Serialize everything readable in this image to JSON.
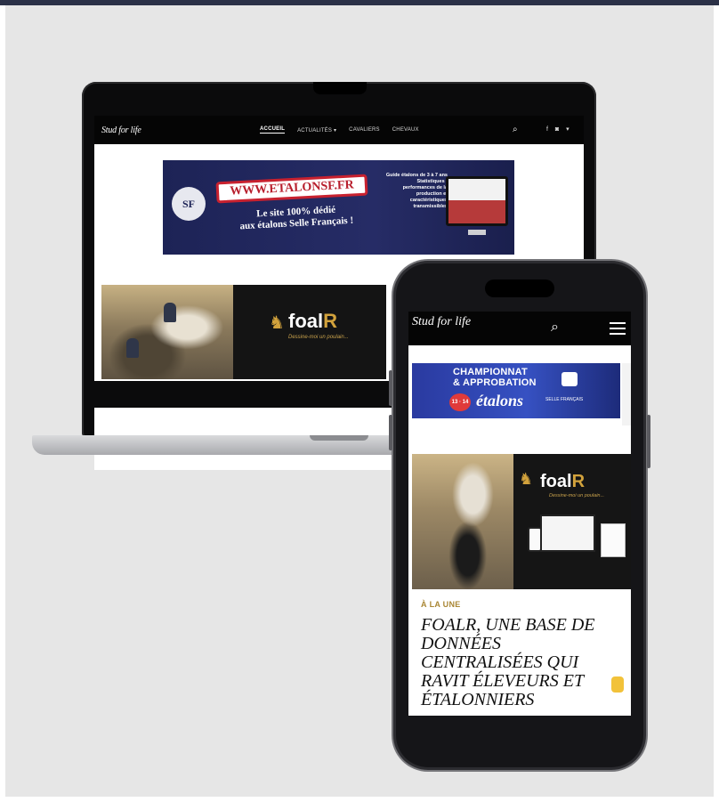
{
  "colors": {
    "border_top": "#2b3147",
    "background": "#e6e6e6",
    "device_black": "#0b0b0c",
    "gold_accent": "#d2a23c",
    "banner_navy": "#1d2356",
    "banner_red": "#c8212f"
  },
  "laptop": {
    "logo": "Stud for life",
    "nav": {
      "items": [
        "ACCUEIL",
        "ACTUALITÉS ▾",
        "CAVALIERS",
        "CHEVAUX"
      ],
      "search_icon": "search-icon",
      "social_icons": "f ◙ ▾"
    },
    "banner": {
      "badge": "SF",
      "url": "WWW.ETALONSF.FR",
      "tagline_line1": "Le site 100% dédié",
      "tagline_line2": "aux étalons Selle Français !",
      "side_text": "Guide étalons de 3 à 7 ans Statistiques : performances de la production et caractéristiques transmissibles"
    },
    "foalr": {
      "logo_main": "foal",
      "logo_r": "R",
      "subtitle": "Dessine-moi un poulain..."
    }
  },
  "phone": {
    "logo": "Stud for life",
    "banner": {
      "title_line1": "CHAMPIONNAT",
      "title_line2": "& APPROBATION",
      "date": "13 · 14",
      "etalons": "étalons",
      "subtitle": "SELLE FRANÇAIS"
    },
    "foalr": {
      "logo_main": "foal",
      "logo_r": "R",
      "subtitle": "Dessine-moi un poulain..."
    },
    "kicker": "À LA UNE",
    "headline": "FOALR, UNE BASE DE DONNÉES CENTRALISÉES QUI RAVIT ÉLEVEURS ET ÉTALONNIERS"
  }
}
